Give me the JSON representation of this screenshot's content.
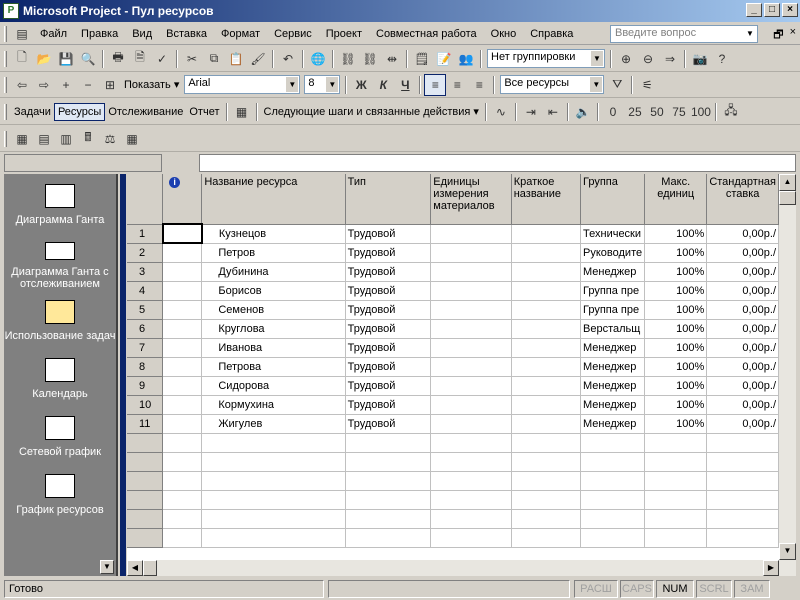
{
  "window": {
    "title": "Microsoft Project - Пул ресурсов",
    "app_icon": "project-icon"
  },
  "menu": {
    "items": [
      "Файл",
      "Правка",
      "Вид",
      "Вставка",
      "Формат",
      "Сервис",
      "Проект",
      "Совместная работа",
      "Окно",
      "Справка"
    ],
    "help_placeholder": "Введите вопрос"
  },
  "toolbar_standard": {
    "grouping": "Нет группировки"
  },
  "toolbar_format": {
    "show_label": "Показать",
    "font": "Arial",
    "size": "8",
    "bold": "Ж",
    "italic": "К",
    "underline": "Ч",
    "filter": "Все ресурсы"
  },
  "toolbar_tracking": {
    "tasks": "Задачи",
    "resources": "Ресурсы",
    "tracking": "Отслеживание",
    "report": "Отчет",
    "next_steps": "Следующие шаги и связанные действия",
    "pct": [
      "0",
      "25",
      "50",
      "75",
      "100"
    ]
  },
  "view_bar": {
    "items": [
      {
        "label": "Диаграмма Ганта",
        "icon": "gantt-chart-icon"
      },
      {
        "label": "Диаграмма Ганта с отслеживанием",
        "icon": "tracking-gantt-icon"
      },
      {
        "label": "Использование задач",
        "icon": "task-usage-icon"
      },
      {
        "label": "Календарь",
        "icon": "calendar-icon"
      },
      {
        "label": "Сетевой график",
        "icon": "network-diagram-icon"
      },
      {
        "label": "График ресурсов",
        "icon": "resource-graph-icon"
      }
    ]
  },
  "grid": {
    "columns": [
      "",
      "Название ресурса",
      "Тип",
      "Единицы измерения материалов",
      "Краткое название",
      "Группа",
      "Макс. единиц",
      "Стандартная ставка"
    ],
    "rows": [
      {
        "n": "1",
        "name": "Кузнецов",
        "type": "Трудовой",
        "group": "Технически",
        "max": "100%",
        "rate": "0,00р./"
      },
      {
        "n": "2",
        "name": "Петров",
        "type": "Трудовой",
        "group": "Руководите",
        "max": "100%",
        "rate": "0,00р./"
      },
      {
        "n": "3",
        "name": "Дубинина",
        "type": "Трудовой",
        "group": "Менеджер",
        "max": "100%",
        "rate": "0,00р./"
      },
      {
        "n": "4",
        "name": "Борисов",
        "type": "Трудовой",
        "group": "Группа пре",
        "max": "100%",
        "rate": "0,00р./"
      },
      {
        "n": "5",
        "name": "Семенов",
        "type": "Трудовой",
        "group": "Группа пре",
        "max": "100%",
        "rate": "0,00р./"
      },
      {
        "n": "6",
        "name": "Круглова",
        "type": "Трудовой",
        "group": "Верстальщ",
        "max": "100%",
        "rate": "0,00р./"
      },
      {
        "n": "7",
        "name": "Иванова",
        "type": "Трудовой",
        "group": "Менеджер",
        "max": "100%",
        "rate": "0,00р./"
      },
      {
        "n": "8",
        "name": "Петрова",
        "type": "Трудовой",
        "group": "Менеджер",
        "max": "100%",
        "rate": "0,00р./"
      },
      {
        "n": "9",
        "name": "Сидорова",
        "type": "Трудовой",
        "group": "Менеджер",
        "max": "100%",
        "rate": "0,00р./"
      },
      {
        "n": "10",
        "name": "Кормухина",
        "type": "Трудовой",
        "group": "Менеджер",
        "max": "100%",
        "rate": "0,00р./"
      },
      {
        "n": "11",
        "name": "Жигулев",
        "type": "Трудовой",
        "group": "Менеджер",
        "max": "100%",
        "rate": "0,00р./"
      }
    ]
  },
  "status": {
    "text": "Готово",
    "indicators": [
      "РАСШ",
      "CAPS",
      "NUM",
      "SCRL",
      "ЗАМ"
    ],
    "active": "NUM"
  }
}
